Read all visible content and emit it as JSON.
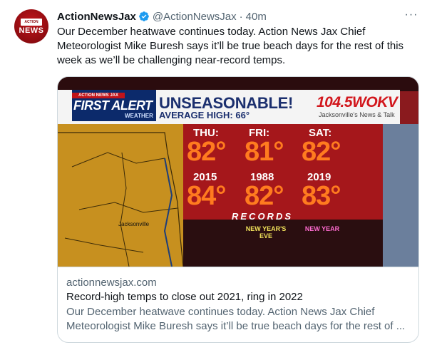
{
  "tweet": {
    "display_name": "ActionNewsJax",
    "handle": "@ActionNewsJax",
    "separator": "·",
    "time": "40m",
    "more_label": "···",
    "text": "Our December heatwave continues today. Action News Jax Chief Meteorologist Mike Buresh says it’ll be true beach days for the rest of this week as we’ll be challenging near-record temps.",
    "avatar_text": "NEWS",
    "avatar_badge_text": "ACTION NEWS JAX"
  },
  "card": {
    "domain": "actionnewsjax.com",
    "title": "Record-high temps to close out 2021, ring in 2022",
    "description_line1": "Our December heatwave continues today. Action News Jax Chief",
    "description_line2": "Meteorologist Mike Buresh says it’ll be true beach days for the rest of ..."
  },
  "graphic": {
    "tag": "ACTION NEWS JAX",
    "first_alert": "FIRST ALERT",
    "weather": "WEATHER",
    "headline": "UNSEASONABLE!",
    "subhead": "AVERAGE HIGH: 66°",
    "station": "104.5WOKV",
    "station_sub": "Jacksonville's News & Talk",
    "map_city": "Jacksonville",
    "days": [
      {
        "day": "THU:",
        "temp": "82°",
        "year": "2015",
        "record": "84°"
      },
      {
        "day": "FRI:",
        "temp": "81°",
        "year": "1988",
        "record": "82°"
      },
      {
        "day": "SAT:",
        "temp": "82°",
        "year": "2019",
        "record": "83°"
      }
    ],
    "records_label": "RECORDS",
    "nye_left": "NEW YEAR'S EVE",
    "nye_right": "NEW YEAR"
  },
  "colors": {
    "verified_blue": "#1d9bf0",
    "alert_red": "#a5171b",
    "temp_orange": "#ff7b1f",
    "navy": "#1b2f6e"
  }
}
